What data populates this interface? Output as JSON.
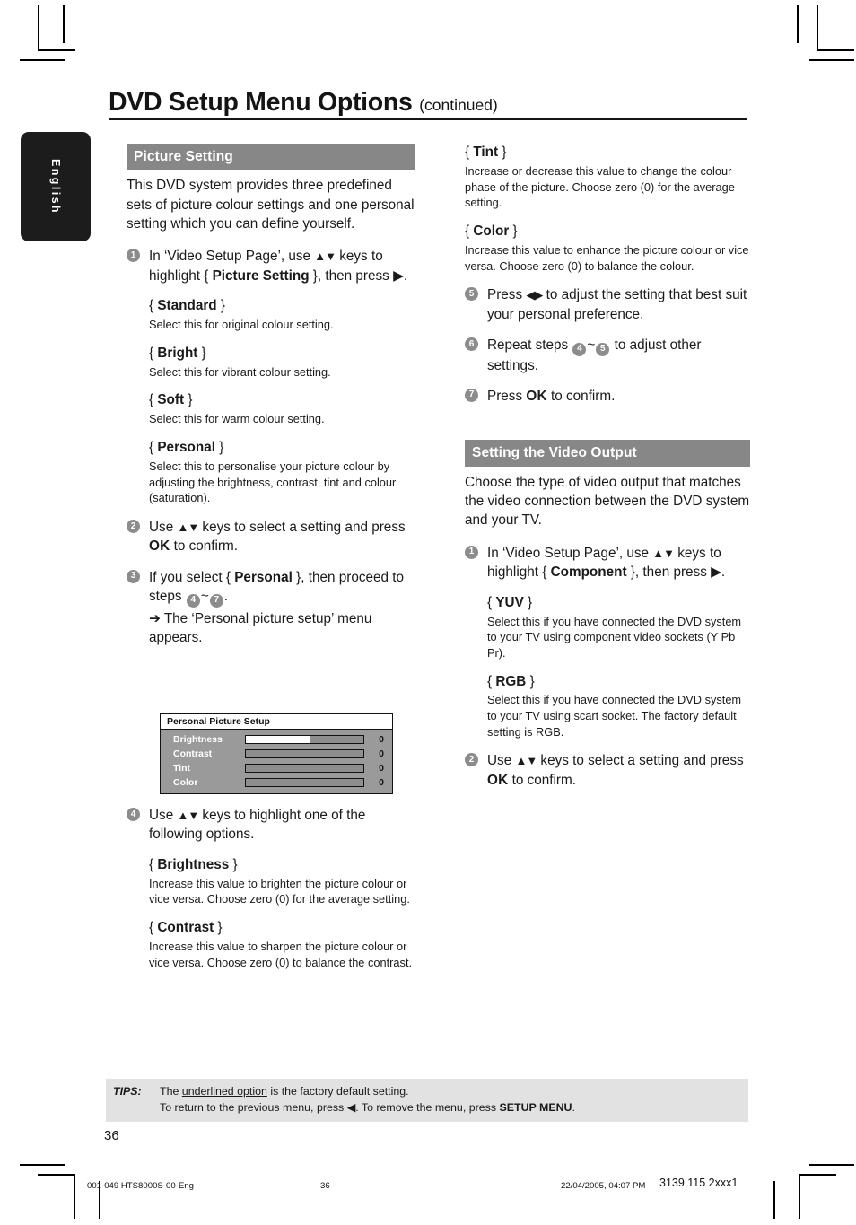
{
  "language_tab": "English",
  "header": {
    "title": "DVD Setup Menu Options",
    "continued": "(continued)"
  },
  "left_column": {
    "section_title": "Picture Setting",
    "intro": "This DVD system provides three predefined sets of picture colour settings and one personal setting which you can define yourself.",
    "step1": {
      "number": "1",
      "text_a": "In ‘Video Setup Page’, use ",
      "keys": "▲▼",
      "text_b": " keys to highlight { ",
      "bold": "Picture Setting",
      "text_c": " }, then press ",
      "arrow": "▶",
      "text_d": "."
    },
    "options": [
      {
        "name": "Standard",
        "underlined": true,
        "desc": "Select this for original colour setting."
      },
      {
        "name": "Bright",
        "underlined": false,
        "desc": "Select this for vibrant colour setting."
      },
      {
        "name": "Soft",
        "underlined": false,
        "desc": "Select this for warm colour setting."
      },
      {
        "name": "Personal",
        "underlined": false,
        "desc": "Select this to personalise your picture colour by adjusting the brightness, contrast, tint and colour (saturation)."
      }
    ],
    "step2": {
      "number": "2",
      "text_a": "Use ",
      "keys": "▲▼",
      "text_b": " keys to select a setting and press ",
      "bold": "OK",
      "text_c": " to confirm."
    },
    "step3": {
      "number": "3",
      "text_a": "If you select { ",
      "bold": "Personal",
      "text_b": " }, then proceed to steps ",
      "range_from": "4",
      "tilde": "~",
      "range_to": "7",
      "text_c": ".",
      "note_arrow": "➔",
      "note": "The ‘Personal picture setup’ menu appears."
    },
    "osd_menu": {
      "title": "Personal Picture Setup",
      "rows": [
        {
          "label": "Brightness",
          "value": "0",
          "fill_percent": 55
        },
        {
          "label": "Contrast",
          "value": "0",
          "fill_percent": 0
        },
        {
          "label": "Tint",
          "value": "0",
          "fill_percent": 0
        },
        {
          "label": "Color",
          "value": "0",
          "fill_percent": 0
        }
      ]
    },
    "step4": {
      "number": "4",
      "text_a": "Use ",
      "keys": "▲▼",
      "text_b": " keys to highlight one of the following options."
    },
    "options2": [
      {
        "name": "Brightness",
        "desc": "Increase this value to brighten the picture colour or vice versa. Choose zero (0) for the average setting."
      },
      {
        "name": "Contrast",
        "desc": "Increase this value to sharpen the picture colour or vice versa.  Choose zero (0) to balance the contrast."
      }
    ]
  },
  "right_column": {
    "options3": [
      {
        "name": "Tint",
        "desc": "Increase or decrease this value to change the colour phase of the picture.  Choose zero (0) for the average setting."
      },
      {
        "name": "Color",
        "desc": "Increase this value to enhance the picture colour or vice versa. Choose zero (0) to balance the colour."
      }
    ],
    "step5": {
      "number": "5",
      "text_a": "Press ",
      "keys": "◀▶",
      "text_b": "  to adjust the setting that best suit your personal preference."
    },
    "step6": {
      "number": "6",
      "text_a": "Repeat steps ",
      "range_from": "4",
      "tilde": "~",
      "range_to": "5",
      "text_b": " to adjust other settings."
    },
    "step7": {
      "number": "7",
      "text_a": "Press ",
      "bold": "OK",
      "text_b": " to confirm."
    },
    "section_title": "Setting the Video Output",
    "intro": "Choose the type of video output that matches the video connection between the DVD system and your TV.",
    "step1": {
      "number": "1",
      "text_a": "In ‘Video Setup Page’, use ",
      "keys": "▲▼",
      "text_b": " keys to highlight { ",
      "bold": "Component",
      "text_c": " }, then press ",
      "arrow": "▶",
      "text_d": "."
    },
    "options4": [
      {
        "name": "YUV",
        "underlined": false,
        "desc": "Select this if you have connected the DVD system to your TV using component video sockets (Y Pb Pr)."
      },
      {
        "name": "RGB",
        "underlined": true,
        "desc": "Select this if you have connected the DVD system to your TV using scart socket. The factory default setting is RGB."
      }
    ],
    "step2": {
      "number": "2",
      "text_a": "Use ",
      "keys": "▲▼",
      "text_b": " keys to select a setting and press ",
      "bold": "OK",
      "text_c": " to confirm."
    }
  },
  "tips": {
    "label": "TIPS:",
    "line1_a": "The ",
    "line1_u": "underlined option",
    "line1_b": " is the factory default setting.",
    "line2_a": "To return to the previous menu, press ",
    "line2_arrow": "◀",
    "line2_b": ".  To remove the menu, press ",
    "line2_bold": "SETUP MENU",
    "line2_c": "."
  },
  "page_number": "36",
  "print_footer": {
    "file": "001-049 HTS8000S-00-Eng",
    "page": "36",
    "date": "22/04/2005, 04:07 PM",
    "code": "3139 115 2xxx1"
  }
}
